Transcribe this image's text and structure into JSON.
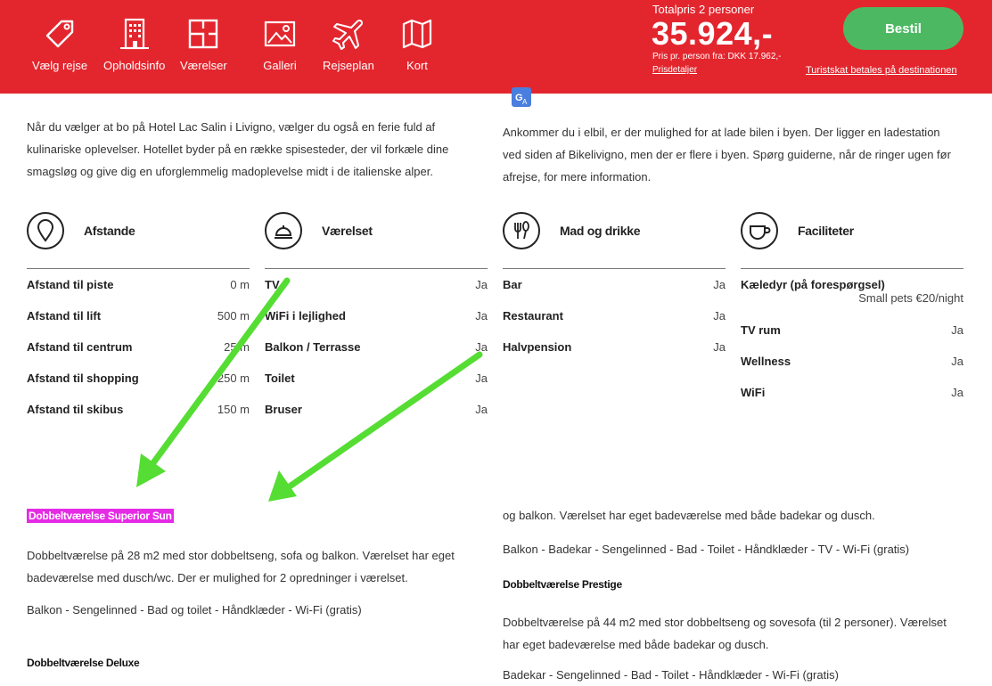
{
  "nav": {
    "items": [
      {
        "label": "Vælg rejse",
        "icon": "tag-icon"
      },
      {
        "label": "Opholdsinfo",
        "icon": "building-icon"
      },
      {
        "label": "Værelser",
        "icon": "floorplan-icon"
      },
      {
        "label": "Galleri",
        "icon": "image-icon"
      },
      {
        "label": "Rejseplan",
        "icon": "plane-icon"
      },
      {
        "label": "Kort",
        "icon": "map-icon"
      }
    ]
  },
  "pricing": {
    "total_label": "Totalpris 2 personer",
    "total": "35.924,-",
    "per_person": "Pris pr. person fra: DKK 17.962,-",
    "details_link": "Prisdetaljer",
    "order_button": "Bestil",
    "tourist_tax": "Turistskat betales på destinationen"
  },
  "intro": {
    "left": "Når du vælger at bo på Hotel Lac Salin i Livigno, vælger du også en ferie fuld af kulinariske oplevelser. Hotellet byder på en række spisesteder, der vil forkæle dine smagsløg og give dig en uforglemmelig madoplevelse midt i de italienske alper.",
    "right": "Ankommer du i elbil, er der mulighed for at lade bilen i byen. Der ligger en ladestation ved siden af Bikelivigno, men der er flere i byen. Spørg guiderne, når de ringer ugen før afrejse, for mere information."
  },
  "tables": {
    "afstande": {
      "title": "Afstande",
      "rows": [
        {
          "k": "Afstand til piste",
          "v": "0 m"
        },
        {
          "k": "Afstand til lift",
          "v": "500 m"
        },
        {
          "k": "Afstand til centrum",
          "v": "25 m"
        },
        {
          "k": "Afstand til shopping",
          "v": "250 m"
        },
        {
          "k": "Afstand til skibus",
          "v": "150 m"
        }
      ]
    },
    "vaerelset": {
      "title": "Værelset",
      "rows": [
        {
          "k": "TV",
          "v": "Ja"
        },
        {
          "k": "WiFi i lejlighed",
          "v": "Ja"
        },
        {
          "k": "Balkon / Terrasse",
          "v": "Ja"
        },
        {
          "k": "Toilet",
          "v": "Ja"
        },
        {
          "k": "Bruser",
          "v": "Ja"
        }
      ]
    },
    "mad": {
      "title": "Mad og drikke",
      "rows": [
        {
          "k": "Bar",
          "v": "Ja"
        },
        {
          "k": "Restaurant",
          "v": "Ja"
        },
        {
          "k": "Halvpension",
          "v": "Ja"
        }
      ]
    },
    "faciliteter": {
      "title": "Faciliteter",
      "pet_k": "Kæledyr (på forespørgsel)",
      "pet_note": "Small pets €20/night",
      "rows": [
        {
          "k": "TV rum",
          "v": "Ja"
        },
        {
          "k": "Wellness",
          "v": "Ja"
        },
        {
          "k": "WiFi",
          "v": "Ja"
        }
      ]
    }
  },
  "rooms": {
    "superior_title": "Dobbeltværelse Superior Sun",
    "superior_desc": "Dobbeltværelse på 28 m2 med stor dobbeltseng, sofa og balkon. Værelset har eget badeværelse med dusch/wc. Der er mulighed for 2 opredninger i værelset.",
    "superior_amen": "Balkon - Sengelinned - Bad og toilet - Håndklæder - Wi-Fi (gratis)",
    "deluxe_title": "Dobbeltværelse Deluxe",
    "right_cont": "og balkon. Værelset har eget badeværelse med både badekar og dusch.",
    "right_amen": "Balkon - Badekar - Sengelinned - Bad - Toilet - Håndklæder - TV - Wi-Fi (gratis)",
    "prestige_title": "Dobbeltværelse Prestige",
    "prestige_desc": "Dobbeltværelse på 44 m2 med stor dobbeltseng og sovesofa (til 2 personer). Værelset har eget badeværelse med både badekar og dusch.",
    "prestige_amen": "Badekar - Sengelinned - Bad - Toilet - Håndklæder - Wi-Fi (gratis)"
  },
  "colors": {
    "brand_red": "#e3262e",
    "order_green": "#4cb962",
    "highlight": "#e52be5",
    "arrow": "#55dd33"
  }
}
